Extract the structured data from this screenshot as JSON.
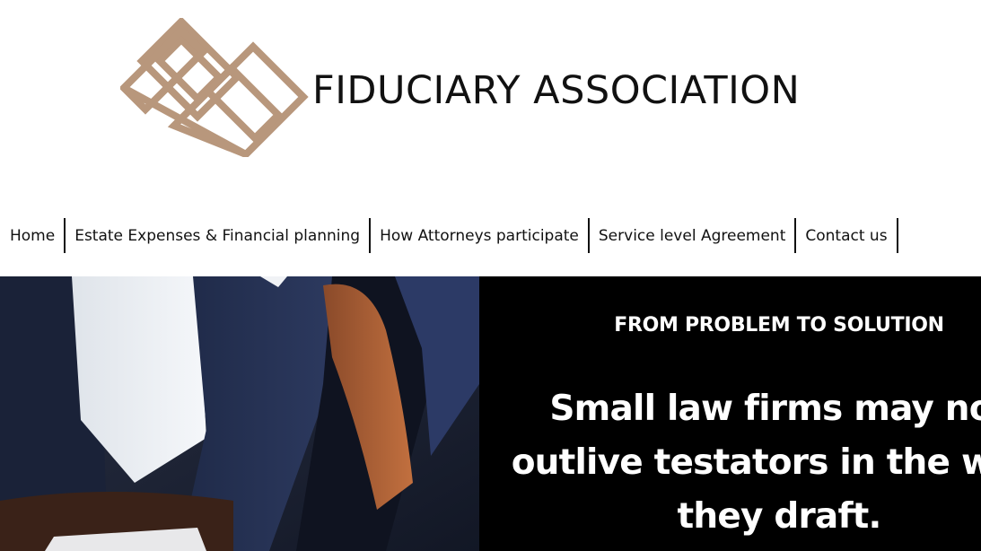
{
  "header": {
    "site_title": "FIDUCIARY ASSOCIATION",
    "logo_icon": "interlocked-diamond-logo-icon",
    "brand_color": "#b8977c"
  },
  "nav": {
    "items": [
      {
        "label": "Home"
      },
      {
        "label": "Estate Expenses & Financial planning"
      },
      {
        "label": "How Attorneys participate"
      },
      {
        "label": "Service level Agreement"
      },
      {
        "label": "Contact us"
      }
    ]
  },
  "hero": {
    "image_subject": "person in navy suit and white shirt",
    "eyebrow": "FROM PROBLEM TO SOLUTION",
    "headline": "Small law firms may not outlive testators in the wills they draft.",
    "panel_color": "#000000",
    "text_color": "#ffffff"
  }
}
